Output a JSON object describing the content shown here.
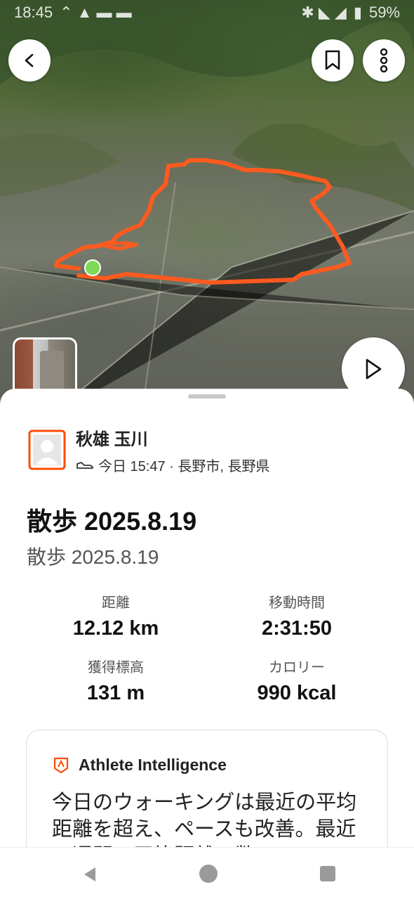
{
  "status_bar": {
    "time": "18:45",
    "battery": "59%"
  },
  "map": {
    "route_color": "#ff5a1f",
    "start_marker_color": "#7ed957"
  },
  "header_buttons": {
    "back_icon": "chevron-left-icon",
    "bookmark_icon": "bookmark-icon",
    "more_icon": "more-vertical-icon",
    "play_icon": "play-icon"
  },
  "athlete": {
    "name": "秋雄 玉川",
    "meta": "今日 15:47 · 長野市, 長野県"
  },
  "activity": {
    "title": "散歩 2025.8.19",
    "subtitle": "散歩 2025.8.19"
  },
  "stats": [
    {
      "label": "距離",
      "value": "12.12 km"
    },
    {
      "label": "移動時間",
      "value": "2:31:50"
    },
    {
      "label": "獲得標高",
      "value": "131 m"
    },
    {
      "label": "カロリー",
      "value": "990 kcal"
    }
  ],
  "athlete_intelligence": {
    "title": "Athlete Intelligence",
    "text": "今日のウォーキングは最近の平均距離を超え、ペースも改善。最近の週間の平均距離の数"
  },
  "colors": {
    "accent": "#fc4c02",
    "text": "#111111",
    "muted": "#555555"
  }
}
